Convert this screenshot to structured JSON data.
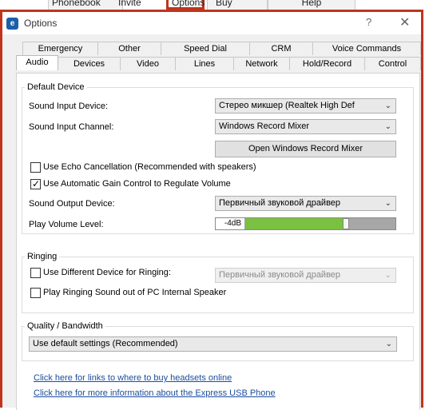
{
  "menubar": {
    "items": [
      "Phonebook",
      "Invite",
      "Options",
      "Buy Online",
      "Help"
    ]
  },
  "dialog": {
    "title": "Options",
    "help": "?",
    "close": "✕"
  },
  "tabs": {
    "back": [
      "Emergency",
      "Other",
      "Speed Dial",
      "CRM",
      "Voice Commands"
    ],
    "front": [
      "Audio",
      "Devices",
      "Video",
      "Lines",
      "Network",
      "Hold/Record",
      "Control"
    ],
    "active": "Audio"
  },
  "default_device": {
    "title": "Default Device",
    "sound_input_label": "Sound Input Device:",
    "sound_input_value": "Стерео микшер (Realtek High Def",
    "input_channel_label": "Sound Input Channel:",
    "input_channel_value": "Windows Record Mixer",
    "open_mixer_label": "Open Windows Record Mixer",
    "echo_label": "Use Echo Cancellation (Recommended with speakers)",
    "echo_checked": false,
    "agc_label": "Use Automatic Gain Control to Regulate Volume",
    "agc_checked": true,
    "output_label": "Sound Output Device:",
    "output_value": "Первичный звуковой драйвер",
    "volume_label": "Play Volume Level:",
    "volume_value": "-4dB",
    "volume_fraction": 0.67
  },
  "ringing": {
    "title": "Ringing",
    "diff_device_label": "Use Different Device for Ringing:",
    "diff_device_checked": false,
    "ring_device_value": "Первичный звуковой драйвер",
    "pc_speaker_label": "Play Ringing Sound out of PC Internal Speaker",
    "pc_speaker_checked": false
  },
  "quality": {
    "title": "Quality / Bandwidth",
    "value": "Use default settings (Recommended)"
  },
  "links": {
    "headsets": "Click here for links to where to buy headsets online",
    "usb_phone": "Click here for more information about the Express USB Phone"
  },
  "colors": {
    "accent_border": "#c0341d",
    "volume_fill": "#7ac142",
    "link": "#1a4d9c"
  }
}
